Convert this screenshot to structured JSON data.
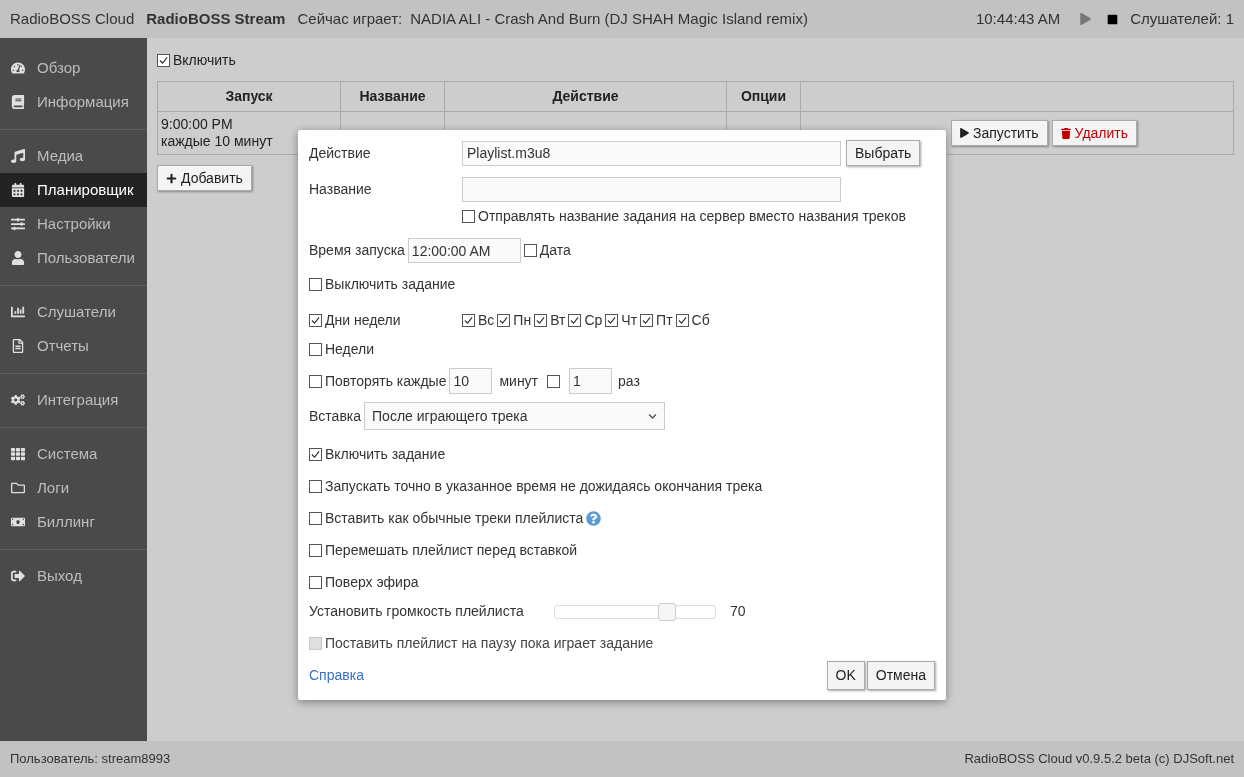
{
  "header": {
    "app": "RadioBOSS Cloud",
    "station": "RadioBOSS Stream",
    "now_playing_label": "Сейчас играет:",
    "now_playing": "NADIA ALI - Crash And Burn (DJ SHAH Magic Island remix)",
    "time": "10:44:43 AM",
    "listeners": "Слушателей: 1"
  },
  "sidebar": {
    "groups": [
      [
        {
          "label": "Обзор",
          "selected": false
        },
        {
          "label": "Информация",
          "selected": false
        }
      ],
      [
        {
          "label": "Медиа",
          "selected": false
        },
        {
          "label": "Планировщик",
          "selected": true
        },
        {
          "label": "Настройки",
          "selected": false
        },
        {
          "label": "Пользователи",
          "selected": false
        }
      ],
      [
        {
          "label": "Слушатели",
          "selected": false
        },
        {
          "label": "Отчеты",
          "selected": false
        }
      ],
      [
        {
          "label": "Интеграция",
          "selected": false
        }
      ],
      [
        {
          "label": "Система",
          "selected": false
        },
        {
          "label": "Логи",
          "selected": false
        },
        {
          "label": "Биллинг",
          "selected": false
        }
      ],
      [
        {
          "label": "Выход",
          "selected": false
        }
      ]
    ]
  },
  "enable": {
    "label": "Включить",
    "checked": true
  },
  "table": {
    "columns": [
      "Запуск",
      "Название",
      "Действие",
      "Опции"
    ],
    "rows": [
      {
        "launch": [
          "9:00:00 PM",
          "каждые 10 минут"
        ],
        "buttons": [
          "Запустить",
          "Удалить"
        ]
      }
    ]
  },
  "add_button": "Добавить",
  "dialog": {
    "action": {
      "label": "Действие",
      "value": "Playlist.m3u8",
      "button": "Выбрать"
    },
    "name": {
      "label": "Название",
      "send_name": {
        "label": "Отправлять название задания на сервер вместо названия треков",
        "checked": false
      }
    },
    "start_time": {
      "label": "Время запуска",
      "value": "12:00:00 AM",
      "date": {
        "label": "Дата",
        "checked": false
      }
    },
    "disable": {
      "label": "Выключить задание",
      "checked": false
    },
    "weekdays": {
      "label": "Дни недели",
      "checked": true,
      "days": [
        {
          "label": "Вс",
          "checked": true
        },
        {
          "label": "Пн",
          "checked": true
        },
        {
          "label": "Вт",
          "checked": true
        },
        {
          "label": "Ср",
          "checked": true
        },
        {
          "label": "Чт",
          "checked": true
        },
        {
          "label": "Пт",
          "checked": true
        },
        {
          "label": "Сб",
          "checked": true
        }
      ]
    },
    "weeks": {
      "label": "Недели",
      "checked": false
    },
    "repeat": {
      "label": "Повторять каждые",
      "checked": false,
      "value": "10",
      "unit": "минут",
      "times_checked": false,
      "times": "1",
      "times_unit": "раз"
    },
    "insert": {
      "label": "Вставка",
      "value": "После играющего трека"
    },
    "options": [
      {
        "label": "Включить задание",
        "checked": true,
        "help": false
      },
      {
        "label": "Запускать точно в указанное время не дожидаясь окончания трека",
        "checked": false,
        "help": false
      },
      {
        "label": "Вставить как обычные треки плейлиста",
        "checked": false,
        "help": true
      },
      {
        "label": "Перемешать плейлист перед вставкой",
        "checked": false,
        "help": false
      },
      {
        "label": "Поверх эфира",
        "checked": false,
        "help": false
      }
    ],
    "volume": {
      "label": "Установить громкость плейлиста",
      "level": 0.7,
      "reading": "70"
    },
    "pause": {
      "label": "Поставить плейлист на паузу пока играет задание",
      "checked": false,
      "disabled": true
    },
    "help_link": "Справка",
    "ok": "OK",
    "cancel": "Отмена"
  },
  "footer": {
    "user": "Пользователь: stream8993",
    "version": "RadioBOSS Cloud v0.9.5.2 beta (c) DJSoft.net"
  }
}
